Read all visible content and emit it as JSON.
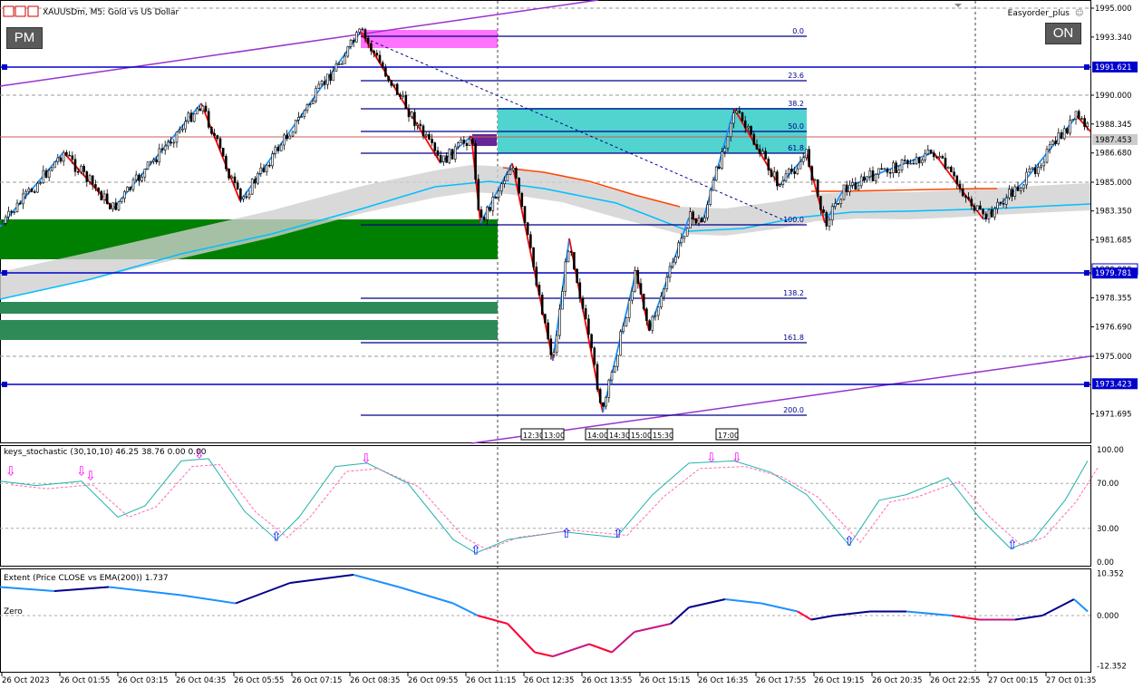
{
  "header": {
    "symbol_title": "XAUUSDm, M5:  Gold vs US Dollar",
    "expert_name": "Easyorder_plus",
    "pm_button": "PM",
    "on_button": "ON"
  },
  "main_chart": {
    "price_scale": [
      "1995.000",
      "1993.340",
      "1991.621",
      "1990.000",
      "1988.345",
      "1987.453",
      "1986.680",
      "1985.000",
      "1983.350",
      "1981.685",
      "1980.000",
      "1979.781",
      "1978.355",
      "1976.690",
      "1975.000",
      "1973.423",
      "1971.695"
    ],
    "fib_levels": [
      "0.0",
      "23.6",
      "38.2",
      "50.0",
      "61.8",
      "100.0",
      "138.2",
      "161.8",
      "200.0"
    ],
    "time_markers": [
      "12:30",
      "13:00",
      "14:00",
      "14:30",
      "15:00",
      "15:30",
      "17:00"
    ],
    "colors": {
      "bull_leg": "#1e90ff",
      "bear_leg": "#ff0000",
      "fib_line": "#00008b",
      "level_line": "#0000cd",
      "channel": "#9932cc",
      "ema_fast": "#ff4500",
      "ema_slow": "#00bfff",
      "supply_zone": "#ff00ff",
      "demand_zone": "#008000",
      "fvg_zone": "#48d1cc"
    }
  },
  "stochastic_panel": {
    "title": "keys_stochastic (30,10,10) 46.25 38.76 0.00 0.00",
    "scale": [
      "100.00",
      "70.00",
      "30.00",
      "0.00"
    ]
  },
  "extent_panel": {
    "title": "Extent (Price CLOSE vs EMA(200)) 1.737",
    "zero_label": "Zero",
    "scale": [
      "10.352",
      "0.000",
      "-12.352"
    ]
  },
  "time_axis": [
    "26 Oct 2023",
    "26 Oct 01:55",
    "26 Oct 03:15",
    "26 Oct 04:35",
    "26 Oct 05:55",
    "26 Oct 07:15",
    "26 Oct 08:35",
    "26 Oct 09:55",
    "26 Oct 11:15",
    "26 Oct 12:35",
    "26 Oct 13:55",
    "26 Oct 15:15",
    "26 Oct 16:35",
    "26 Oct 17:55",
    "26 Oct 19:15",
    "26 Oct 20:35",
    "26 Oct 22:55",
    "27 Oct 00:15",
    "27 Oct 01:35"
  ]
}
